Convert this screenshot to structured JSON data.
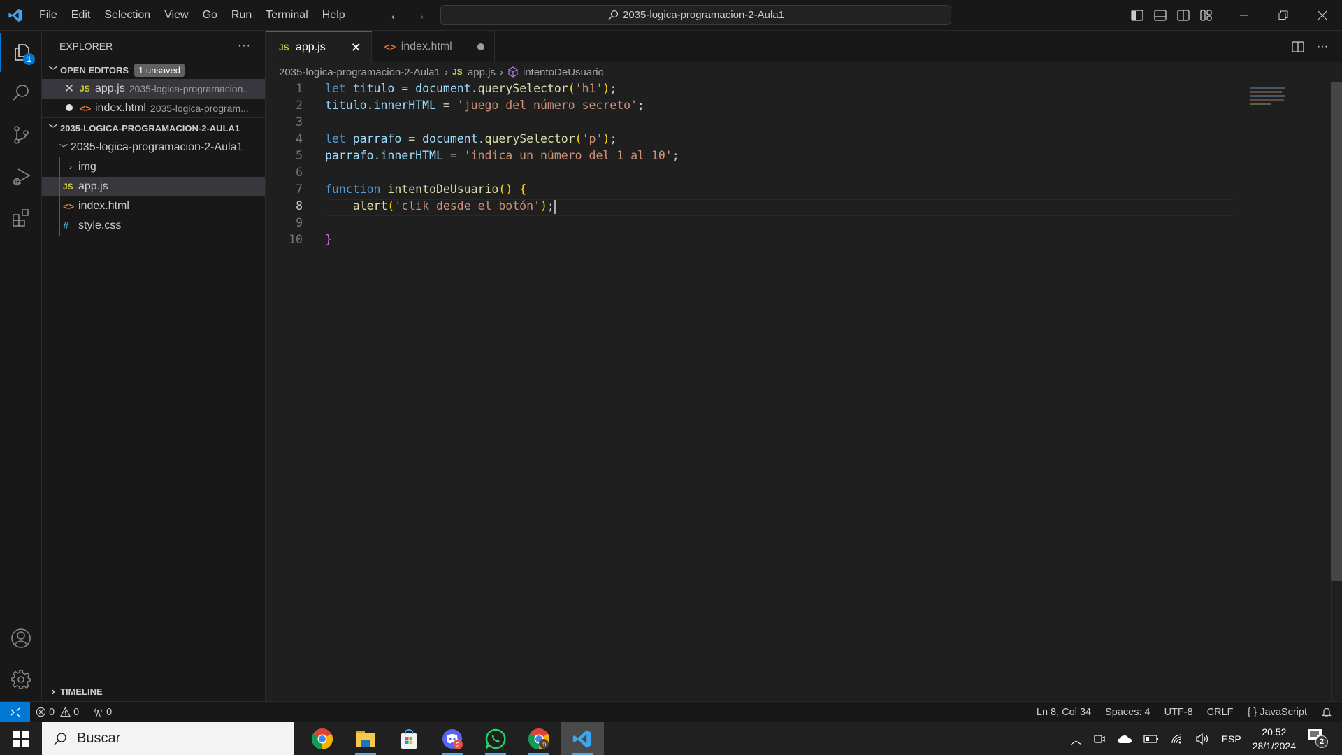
{
  "titlebar": {
    "menu": [
      "File",
      "Edit",
      "Selection",
      "View",
      "Go",
      "Run",
      "Terminal",
      "Help"
    ],
    "command_center": "2035-logica-programacion-2-Aula1"
  },
  "activity_bar": {
    "explorer_badge": "1"
  },
  "sidebar": {
    "title": "EXPLORER",
    "more": "···",
    "open_editors": {
      "label": "OPEN EDITORS",
      "badge": "1 unsaved",
      "items": [
        {
          "name": "app.js",
          "desc": "2035-logica-programacion...",
          "icon": "js-icon",
          "state": "close"
        },
        {
          "name": "index.html",
          "desc": "2035-logica-program...",
          "icon": "html-icon",
          "state": "dirty"
        }
      ]
    },
    "workspace": {
      "label": "2035-LOGICA-PROGRAMACION-2-AULA1",
      "folder": "2035-logica-programacion-2-Aula1",
      "items": [
        {
          "name": "img",
          "type": "folder"
        },
        {
          "name": "app.js",
          "type": "js"
        },
        {
          "name": "index.html",
          "type": "html"
        },
        {
          "name": "style.css",
          "type": "css"
        }
      ]
    },
    "timeline": "TIMELINE"
  },
  "editor": {
    "tabs": [
      {
        "label": "app.js",
        "icon": "js-icon",
        "active": true
      },
      {
        "label": "index.html",
        "icon": "html-icon",
        "dirty": true
      }
    ],
    "breadcrumb": [
      "2035-logica-programacion-2-Aula1",
      "app.js",
      "intentoDeUsuario"
    ],
    "line_numbers": [
      "1",
      "2",
      "3",
      "4",
      "5",
      "6",
      "7",
      "8",
      "9",
      "10"
    ],
    "current_line": 8,
    "code": [
      "let titulo = document.querySelector('h1');",
      "titulo.innerHTML = 'juego del número secreto';",
      "",
      "let parrafo = document.querySelector('p');",
      "parrafo.innerHTML = 'indica un número del 1 al 10';",
      "",
      "function intentoDeUsuario() {",
      "    alert('clik desde el botón');",
      "",
      "}"
    ]
  },
  "statusbar": {
    "errors": "0",
    "warnings": "0",
    "ports": "0",
    "position": "Ln 8, Col 34",
    "spaces": "Spaces: 4",
    "encoding": "UTF-8",
    "eol": "CRLF",
    "language": "JavaScript"
  },
  "taskbar": {
    "search_placeholder": "Buscar",
    "apps": [
      "Chrome",
      "File Explorer",
      "Microsoft Store",
      "Discord",
      "WhatsApp",
      "Chrome (profile)",
      "Visual Studio Code"
    ],
    "discord_badge": "2",
    "language": "ESP",
    "time": "20:52",
    "date": "28/1/2024",
    "notifications": "2"
  },
  "colors": {
    "accent": "#0078d4",
    "keyword": "#569cd6",
    "variable": "#9cdcfe",
    "function": "#dcdcaa",
    "string": "#ce9178"
  }
}
